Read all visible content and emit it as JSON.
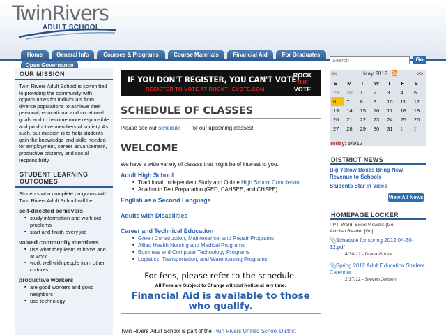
{
  "logo": {
    "title": "TwinRivers",
    "subtitle": "ADULT SCHOOL"
  },
  "nav": {
    "tabs": [
      "Home",
      "General Info",
      "Courses & Programs",
      "Course Materials",
      "Financial Aid",
      "For Graduates",
      "Open Governance"
    ]
  },
  "left": {
    "mission_title": "OUR MISSION",
    "mission_text": "Twin Rivers Adult School is committed to providing the community with opportunities for individuals from diverse populations to achieve their personal, educational and vocational goals and to become more responsible and productive members of society. As such, our mission is to help students gain the knowledge and skills needed for employment, career advancement, productive citizenry and social responsibility.",
    "outcomes_title": "STUDENT LEARNING OUTCOMES",
    "outcomes_intro": "Students who complete programs with Twin Rivers Adult School will be:",
    "groups": [
      {
        "heading": "self-directed achievers",
        "items": [
          "study information and work out problems",
          "start and finish every job"
        ]
      },
      {
        "heading": "valued community members",
        "items": [
          "use what they learn at home and at work",
          "work well with people from other cultures"
        ]
      },
      {
        "heading": "productive workers",
        "items": [
          "are good workers and good neighbors",
          "use technology"
        ]
      }
    ]
  },
  "banner": {
    "line1": "IF YOU DON'T REGISTER, YOU CAN'T VOTE!",
    "line2": "REGISTER TO VOTE AT ROCKTHEVOTE.COM",
    "logo_line1": "ROCK",
    "logo_line2": "THE",
    "logo_line3": "VOTE"
  },
  "main": {
    "schedule_title": "SCHEDULE OF CLASSES",
    "schedule_pre": "Please see our",
    "schedule_link": "schedule",
    "schedule_post": "for our upcoming classes!",
    "welcome_title": "WELCOME",
    "welcome_text": "We have a wide variety of classes that might be of interest to you.",
    "adult_high_title": "Adult High School",
    "adult_high_item1_pre": "Traditional, Independent Study and Online",
    "adult_high_item1_link": "High School Completion",
    "adult_high_item2": "Academic Test Preparation (GED, CAHSEE, and CHSPE)",
    "esl_title": "English as a Second Language",
    "disab_title": "Adults with Disabilities",
    "cte_title": "Career and Technical Education",
    "cte_items": [
      "Green Construction, Maintenance, and Repair Programs",
      "Allied Health Nursing and Medical Programs",
      "Business and Computer Technology Programs",
      "Logistics, Transportation, and Warehousing Programs"
    ],
    "fees_line": "For fees, please refer to the schedule.",
    "fees_note": "All Fees are Subject to Change without Notice at any time.",
    "fin_aid": "Financial Aid is available to those who qualify.",
    "footer_pre": "Twin Rivers Adult School is part of the",
    "footer_link": "Twin Rivers Unified School District"
  },
  "right": {
    "search_placeholder": "Search",
    "search_button": "Go",
    "calendar": {
      "prev": "<<",
      "next": ">>",
      "month": "May 2012",
      "weekdays": [
        "S",
        "M",
        "T",
        "W",
        "T",
        "F",
        "S"
      ],
      "weeks": [
        [
          "29",
          "30",
          "1",
          "2",
          "3",
          "4",
          "5"
        ],
        [
          "6",
          "7",
          "8",
          "9",
          "10",
          "11",
          "12"
        ],
        [
          "13",
          "14",
          "15",
          "16",
          "17",
          "18",
          "19"
        ],
        [
          "20",
          "21",
          "22",
          "23",
          "24",
          "25",
          "26"
        ],
        [
          "27",
          "28",
          "29",
          "30",
          "31",
          "1",
          "2"
        ]
      ],
      "today_label": "Today:",
      "today_value": "5/6/12"
    },
    "news_title": "DISTRICT NEWS",
    "news_items": [
      "Big Yellow Boxes Bring New Revenue to Schools",
      "Students Star in Video"
    ],
    "view_all": "View All News",
    "locker_title": "HOMEPAGE LOCKER",
    "locker_viewers": "PPT, Word, Excel Viewers [Go]",
    "locker_acrobat": "Acrobat Reader [Go]",
    "locker_files": [
      {
        "title": "Schedule for spring 2012 04-30-12.pdf",
        "meta": "4/30/12 - Diana Gontar"
      },
      {
        "title": "Spring 2012 Adult Education Student Calendar",
        "meta": "2/17/12 - Steven Jensen"
      }
    ]
  },
  "colors": {
    "nav_blue": "#2e5c93",
    "link_blue": "#2c61b0",
    "today_highlight": "#f5c400",
    "banner_red": "#d42424"
  }
}
